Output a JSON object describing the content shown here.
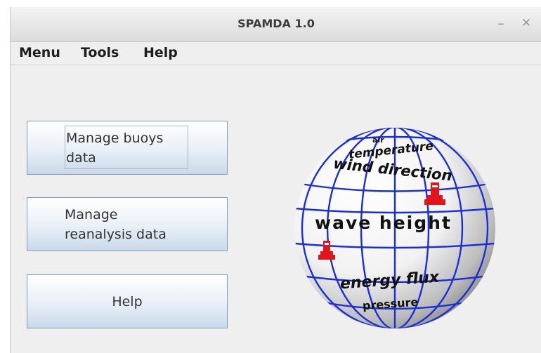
{
  "window": {
    "title": "SPAMDA 1.0",
    "minimize_glyph": "–",
    "close_glyph": "✕"
  },
  "menubar": {
    "items": [
      "Menu",
      "Tools",
      "Help"
    ]
  },
  "buttons": {
    "buoys": {
      "line1": "Manage buoys",
      "line2": "data"
    },
    "reanalysis": {
      "line1": "Manage",
      "line2": "reanalysis data"
    },
    "help": "Help"
  },
  "logo": {
    "words": [
      "air",
      "temperature",
      "wind direction",
      "wave height",
      "energy flux",
      "pressure"
    ],
    "colors": {
      "grid": "#1b2fd6",
      "icon": "#e0161c"
    },
    "icons": [
      "buoy-icon",
      "buoy-icon"
    ]
  }
}
